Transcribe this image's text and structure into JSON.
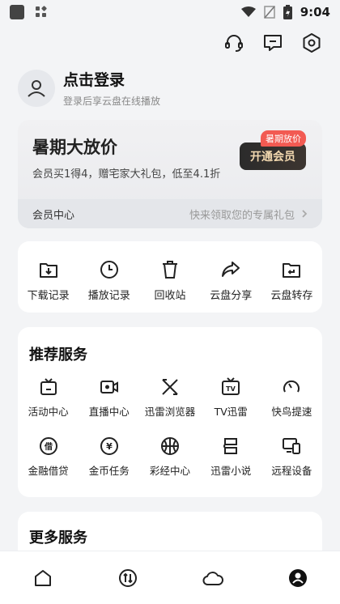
{
  "status_bar": {
    "time": "9:04"
  },
  "header_icons": [
    "headset-icon",
    "feedback-icon",
    "settings-icon"
  ],
  "login": {
    "title": "点击登录",
    "subtitle": "登录后享云盘在线播放"
  },
  "vip": {
    "title": "暑期大放价",
    "desc": "会员买1得4，赠宅家大礼包，低至4.1折",
    "badge": "暑期放价",
    "button": "开通会员",
    "center_label": "会员中心",
    "gift_text": "快来领取您的专属礼包"
  },
  "quick_actions": [
    {
      "label": "下载记录",
      "icon": "download-record-icon"
    },
    {
      "label": "播放记录",
      "icon": "clock-icon"
    },
    {
      "label": "回收站",
      "icon": "trash-icon"
    },
    {
      "label": "云盘分享",
      "icon": "share-icon"
    },
    {
      "label": "云盘转存",
      "icon": "transfer-icon"
    }
  ],
  "services": {
    "title": "推荐服务",
    "items": [
      {
        "label": "活动中心",
        "icon": "tv-box-icon"
      },
      {
        "label": "直播中心",
        "icon": "camera-icon"
      },
      {
        "label": "迅雷浏览器",
        "icon": "browser-x-icon"
      },
      {
        "label": "TV迅雷",
        "icon": "tv-icon"
      },
      {
        "label": "快鸟提速",
        "icon": "speedometer-icon"
      },
      {
        "label": "金融借贷",
        "icon": "loan-icon"
      },
      {
        "label": "金币任务",
        "icon": "coin-icon"
      },
      {
        "label": "彩经中心",
        "icon": "basketball-icon"
      },
      {
        "label": "迅雷小说",
        "icon": "book-icon"
      },
      {
        "label": "远程设备",
        "icon": "remote-device-icon"
      }
    ]
  },
  "more": {
    "title": "更多服务"
  },
  "bottom_nav": [
    {
      "name": "home",
      "icon": "home-icon"
    },
    {
      "name": "transfer",
      "icon": "transfer-arrows-icon"
    },
    {
      "name": "cloud",
      "icon": "cloud-icon"
    },
    {
      "name": "me",
      "icon": "profile-icon",
      "active": true
    }
  ],
  "colors": {
    "accent_red": "#f25a52",
    "vip_gold": "#f3d9b0",
    "dark": "#222222"
  }
}
